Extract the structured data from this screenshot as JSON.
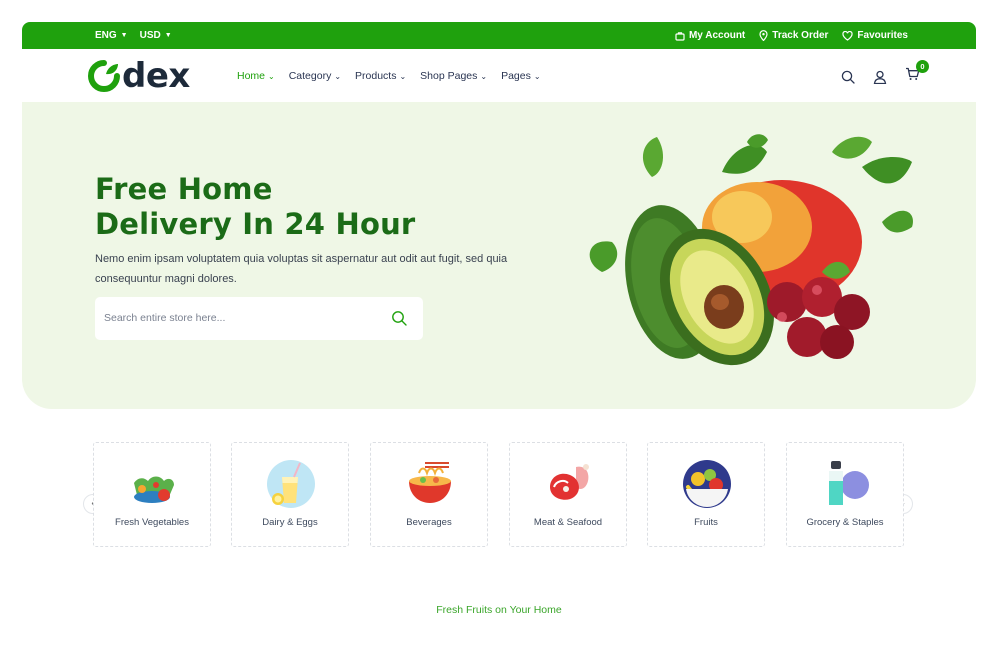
{
  "topbar": {
    "language": "ENG",
    "currency": "USD",
    "account": "My Account",
    "track": "Track Order",
    "favourites": "Favourites"
  },
  "brand": {
    "logo_text": "dex"
  },
  "nav": {
    "items": [
      {
        "label": "Home"
      },
      {
        "label": "Category"
      },
      {
        "label": "Products"
      },
      {
        "label": "Shop Pages"
      },
      {
        "label": "Pages"
      }
    ]
  },
  "cart": {
    "count": "0"
  },
  "hero": {
    "title_line1": "Free Home",
    "title_line2": "Delivery In 24 Hour",
    "description": "Nemo enim ipsam voluptatem quia voluptas sit aspernatur aut odit aut fugit, sed quia consequuntur magni dolores.",
    "search_placeholder": "Search entire store here..."
  },
  "categories": [
    {
      "label": "Fresh Vegetables",
      "icon": "vegetables-icon"
    },
    {
      "label": "Dairy & Eggs",
      "icon": "juice-icon"
    },
    {
      "label": "Beverages",
      "icon": "noodle-bowl-icon"
    },
    {
      "label": "Meat & Seafood",
      "icon": "meat-icon"
    },
    {
      "label": "Fruits",
      "icon": "fruit-bowl-icon"
    },
    {
      "label": "Grocery & Staples",
      "icon": "grocery-icon"
    }
  ],
  "tagline": "Fresh Fruits on Your Home",
  "colors": {
    "brand_green": "#1fa10d",
    "hero_bg": "#eff7e6",
    "title_green": "#1b6b17"
  }
}
